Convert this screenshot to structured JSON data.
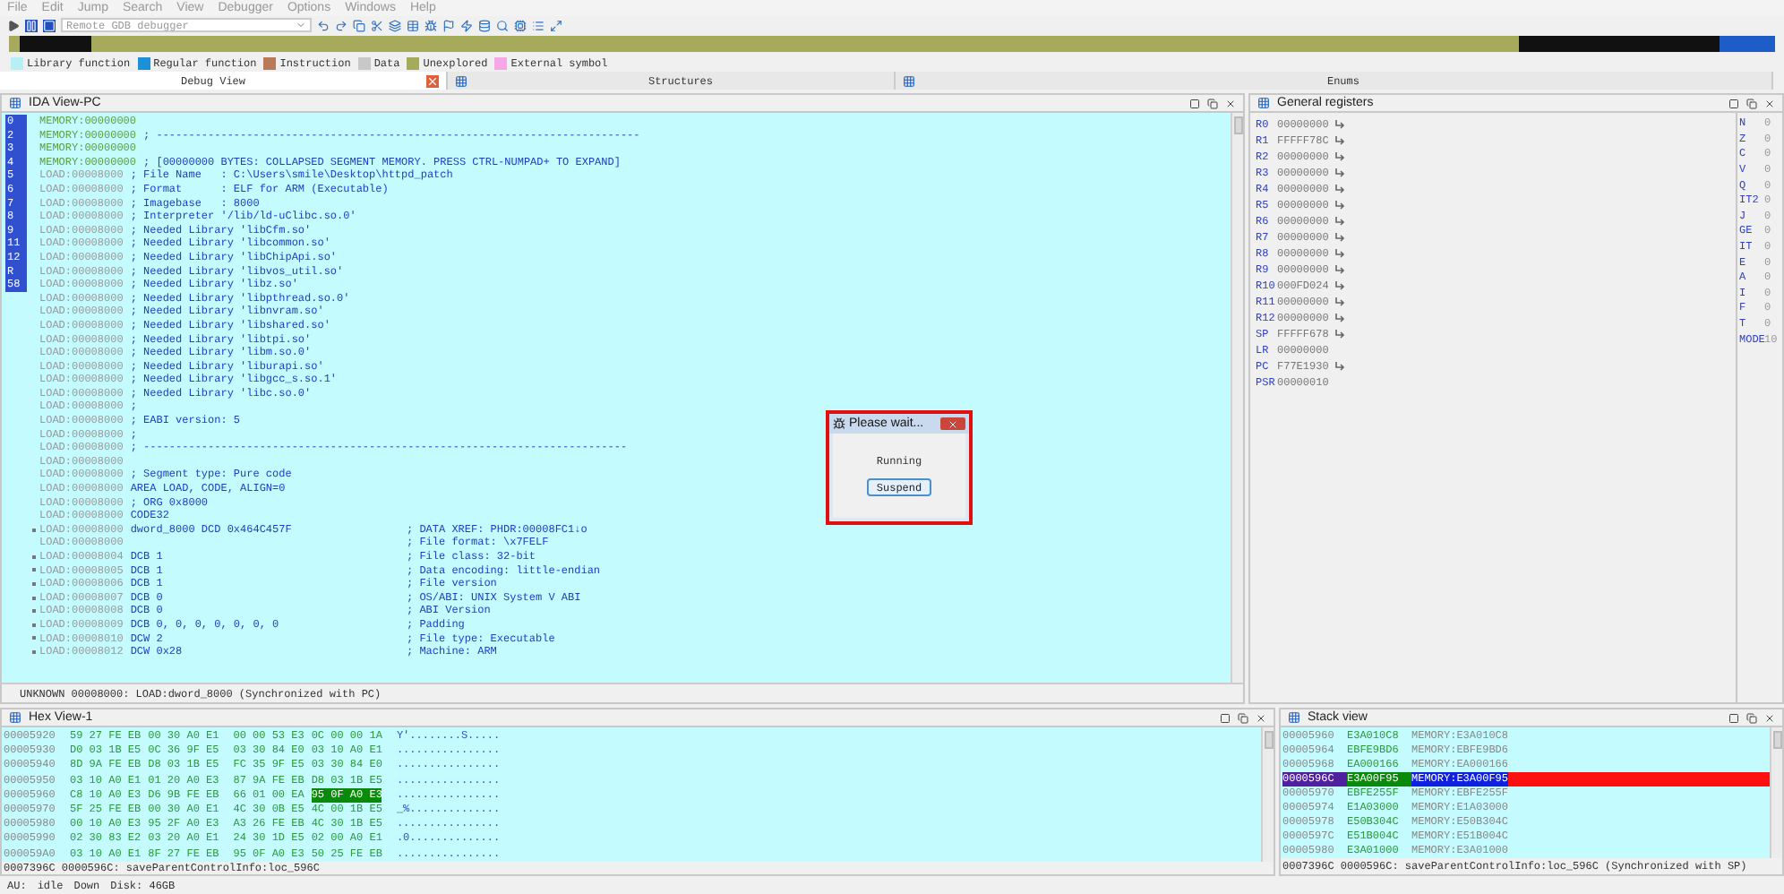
{
  "menu": [
    "File",
    "Edit",
    "Jump",
    "Search",
    "View",
    "Debugger",
    "Options",
    "Windows",
    "Help"
  ],
  "toolbar": {
    "debugger": "Remote GDB debugger"
  },
  "legend": [
    {
      "label": "Library function",
      "color": "#b6f0f5"
    },
    {
      "label": "Regular function",
      "color": "#1e90d8"
    },
    {
      "label": "Instruction",
      "color": "#b97a57"
    },
    {
      "label": "Data",
      "color": "#c8c8c8"
    },
    {
      "label": "Unexplored",
      "color": "#a5ab5a"
    },
    {
      "label": "External symbol",
      "color": "#f7a6e6"
    }
  ],
  "tabs": [
    {
      "label": "Debug View",
      "selected": true
    },
    {
      "label": "Structures",
      "selected": false
    },
    {
      "label": "Enums",
      "selected": false
    }
  ],
  "ida_view": {
    "title": "IDA View-PC",
    "gutter_marks": [
      "0",
      "2",
      "3",
      "4",
      "5",
      "6",
      "7",
      "8",
      "9",
      "11",
      "12",
      "R",
      "58"
    ],
    "lines": [
      {
        "kind": "memory",
        "address": "MEMORY:00000000",
        "marked": false
      },
      {
        "kind": "memory",
        "address": "MEMORY:00000000",
        "code": "; ---------------------------------------------------------------------------",
        "marked": false
      },
      {
        "kind": "memory",
        "address": "MEMORY:00000000",
        "marked": false
      },
      {
        "kind": "memory",
        "address": "MEMORY:00000000",
        "code": "; [00000000 BYTES: COLLAPSED SEGMENT MEMORY. PRESS CTRL-NUMPAD+ TO EXPAND]",
        "marked": false
      },
      {
        "kind": "load",
        "address": "LOAD:00008000",
        "code": "; File Name   : C:\\Users\\smile\\Desktop\\httpd_patch",
        "marked": false
      },
      {
        "kind": "load",
        "address": "LOAD:00008000",
        "code": "; Format      : ELF for ARM (Executable)",
        "marked": false
      },
      {
        "kind": "load",
        "address": "LOAD:00008000",
        "code": "; Imagebase   : 8000",
        "marked": false
      },
      {
        "kind": "load",
        "address": "LOAD:00008000",
        "code": "; Interpreter '/lib/ld-uClibc.so.0'",
        "marked": false
      },
      {
        "kind": "load",
        "address": "LOAD:00008000",
        "code": "; Needed Library 'libCfm.so'",
        "marked": false
      },
      {
        "kind": "load",
        "address": "LOAD:00008000",
        "code": "; Needed Library 'libcommon.so'",
        "marked": false
      },
      {
        "kind": "load",
        "address": "LOAD:00008000",
        "code": "; Needed Library 'libChipApi.so'",
        "marked": false
      },
      {
        "kind": "load",
        "address": "LOAD:00008000",
        "code": "; Needed Library 'libvos_util.so'",
        "marked": false
      },
      {
        "kind": "load",
        "address": "LOAD:00008000",
        "code": "; Needed Library 'libz.so'",
        "marked": false
      },
      {
        "kind": "load",
        "address": "LOAD:00008000",
        "code": "; Needed Library 'libpthread.so.0'",
        "marked": false
      },
      {
        "kind": "load",
        "address": "LOAD:00008000",
        "code": "; Needed Library 'libnvram.so'",
        "marked": false
      },
      {
        "kind": "load",
        "address": "LOAD:00008000",
        "code": "; Needed Library 'libshared.so'",
        "marked": false
      },
      {
        "kind": "load",
        "address": "LOAD:00008000",
        "code": "; Needed Library 'libtpi.so'",
        "marked": false
      },
      {
        "kind": "load",
        "address": "LOAD:00008000",
        "code": "; Needed Library 'libm.so.0'",
        "marked": false
      },
      {
        "kind": "load",
        "address": "LOAD:00008000",
        "code": "; Needed Library 'liburapi.so'",
        "marked": false
      },
      {
        "kind": "load",
        "address": "LOAD:00008000",
        "code": "; Needed Library 'libgcc_s.so.1'",
        "marked": false
      },
      {
        "kind": "load",
        "address": "LOAD:00008000",
        "code": "; Needed Library 'libc.so.0'",
        "marked": false
      },
      {
        "kind": "load",
        "address": "LOAD:00008000",
        "code": ";",
        "marked": false
      },
      {
        "kind": "load",
        "address": "LOAD:00008000",
        "code": "; EABI version: 5",
        "marked": false
      },
      {
        "kind": "load",
        "address": "LOAD:00008000",
        "code": ";",
        "marked": false
      },
      {
        "kind": "load",
        "address": "LOAD:00008000",
        "code": "; ---------------------------------------------------------------------------",
        "marked": false
      },
      {
        "kind": "load",
        "address": "LOAD:00008000",
        "marked": false
      },
      {
        "kind": "load",
        "address": "LOAD:00008000",
        "code": "; Segment type: Pure code",
        "marked": false
      },
      {
        "kind": "load",
        "address": "LOAD:00008000",
        "code": "AREA LOAD, CODE, ALIGN=0",
        "marked": false
      },
      {
        "kind": "load",
        "address": "LOAD:00008000",
        "code": "; ORG 0x8000",
        "marked": false
      },
      {
        "kind": "load",
        "address": "LOAD:00008000",
        "code": "CODE32",
        "marked": false
      },
      {
        "kind": "load",
        "address": "LOAD:00008000",
        "code": "dword_8000 DCD 0x464C457F",
        "comment": "; DATA XREF: PHDR:00008FC1↓o",
        "marked": true
      },
      {
        "kind": "load",
        "address": "LOAD:00008000",
        "comment": "; File format: \\x7FELF",
        "marked": false
      },
      {
        "kind": "load",
        "address": "LOAD:00008004",
        "code": "DCB 1",
        "comment": "; File class: 32-bit",
        "marked": true
      },
      {
        "kind": "load",
        "address": "LOAD:00008005",
        "code": "DCB 1",
        "comment": "; Data encoding: little-endian",
        "marked": true
      },
      {
        "kind": "load",
        "address": "LOAD:00008006",
        "code": "DCB 1",
        "comment": "; File version",
        "marked": true
      },
      {
        "kind": "load",
        "address": "LOAD:00008007",
        "code": "DCB 0",
        "comment": "; OS/ABI: UNIX System V ABI",
        "marked": true
      },
      {
        "kind": "load",
        "address": "LOAD:00008008",
        "code": "DCB 0",
        "comment": "; ABI Version",
        "marked": true
      },
      {
        "kind": "load",
        "address": "LOAD:00008009",
        "code": "DCB 0, 0, 0, 0, 0, 0, 0",
        "comment": "; Padding",
        "marked": true
      },
      {
        "kind": "load",
        "address": "LOAD:00008010",
        "code": "DCW 2",
        "comment": "; File type: Executable",
        "marked": true
      },
      {
        "kind": "load",
        "address": "LOAD:00008012",
        "code": "DCW 0x28",
        "comment": "; Machine: ARM",
        "marked": true
      }
    ],
    "status": "UNKNOWN 00008000: LOAD:dword_8000 (Synchronized with PC)"
  },
  "dialog": {
    "title": "Please wait...",
    "message": "Running",
    "button": "Suspend"
  },
  "registers": {
    "title": "General registers",
    "items": [
      {
        "name": "R0",
        "value": "00000000",
        "link": true
      },
      {
        "name": "R1",
        "value": "FFFFF78C",
        "link": true
      },
      {
        "name": "R2",
        "value": "00000000",
        "link": true
      },
      {
        "name": "R3",
        "value": "00000000",
        "link": true
      },
      {
        "name": "R4",
        "value": "00000000",
        "link": true
      },
      {
        "name": "R5",
        "value": "00000000",
        "link": true
      },
      {
        "name": "R6",
        "value": "00000000",
        "link": true
      },
      {
        "name": "R7",
        "value": "00000000",
        "link": true
      },
      {
        "name": "R8",
        "value": "00000000",
        "link": true
      },
      {
        "name": "R9",
        "value": "00000000",
        "link": true
      },
      {
        "name": "R10",
        "value": "000FD024",
        "link": true
      },
      {
        "name": "R11",
        "value": "00000000",
        "link": true
      },
      {
        "name": "R12",
        "value": "00000000",
        "link": true
      },
      {
        "name": "SP",
        "value": "FFFFF678",
        "link": true
      },
      {
        "name": "LR",
        "value": "00000000",
        "link": false
      },
      {
        "name": "PC",
        "value": "F77E1930",
        "link": true
      },
      {
        "name": "PSR",
        "value": "00000010",
        "link": false
      }
    ],
    "flags": [
      {
        "name": "N",
        "value": "0"
      },
      {
        "name": "Z",
        "value": "0"
      },
      {
        "name": "C",
        "value": "0"
      },
      {
        "name": "V",
        "value": "0"
      },
      {
        "name": "Q",
        "value": "0"
      },
      {
        "name": "IT2",
        "value": "0"
      },
      {
        "name": "J",
        "value": "0"
      },
      {
        "name": "GE",
        "value": "0"
      },
      {
        "name": "IT",
        "value": "0"
      },
      {
        "name": "E",
        "value": "0"
      },
      {
        "name": "A",
        "value": "0"
      },
      {
        "name": "I",
        "value": "0"
      },
      {
        "name": "F",
        "value": "0"
      },
      {
        "name": "T",
        "value": "0"
      },
      {
        "name": "MODE",
        "value": "10"
      }
    ]
  },
  "hex_view": {
    "title": "Hex View-1",
    "rows": [
      {
        "address": "00005920",
        "groups": [
          {
            "text": "59 27 FE EB",
            "selected": false
          },
          {
            "text": "00 30 A0 E1",
            "selected": false
          },
          {
            "text": "00 00 53 E3",
            "selected": false
          },
          {
            "text": "0C 00 00 1A",
            "selected": false
          }
        ],
        "ascii": "Y'........S....."
      },
      {
        "address": "00005930",
        "groups": [
          {
            "text": "D0 03 1B E5",
            "selected": false
          },
          {
            "text": "0C 36 9F E5",
            "selected": false
          },
          {
            "text": "03 30 84 E0",
            "selected": false
          },
          {
            "text": "03 10 A0 E1",
            "selected": false
          }
        ],
        "ascii": "................"
      },
      {
        "address": "00005940",
        "groups": [
          {
            "text": "8D 9A FE EB",
            "selected": false
          },
          {
            "text": "D8 03 1B E5",
            "selected": false
          },
          {
            "text": "FC 35 9F E5",
            "selected": false
          },
          {
            "text": "03 30 84 E0",
            "selected": false
          }
        ],
        "ascii": "................"
      },
      {
        "address": "00005950",
        "groups": [
          {
            "text": "03 10 A0 E1",
            "selected": false
          },
          {
            "text": "01 20 A0 E3",
            "selected": false
          },
          {
            "text": "87 9A FE EB",
            "selected": false
          },
          {
            "text": "D8 03 1B E5",
            "selected": false
          }
        ],
        "ascii": "................"
      },
      {
        "address": "00005960",
        "groups": [
          {
            "text": "C8 10 A0 E3",
            "selected": false
          },
          {
            "text": "D6 9B FE EB",
            "selected": false
          },
          {
            "text": "66 01 00 EA",
            "selected": false
          },
          {
            "text": "95 0F A0 E3",
            "selected": true
          }
        ],
        "ascii": "................"
      },
      {
        "address": "00005970",
        "groups": [
          {
            "text": "5F 25 FE EB",
            "selected": false
          },
          {
            "text": "00 30 A0 E1",
            "selected": false
          },
          {
            "text": "4C 30 0B E5",
            "selected": false
          },
          {
            "text": "4C 00 1B E5",
            "selected": false
          }
        ],
        "ascii": "_%.............."
      },
      {
        "address": "00005980",
        "groups": [
          {
            "text": "00 10 A0 E3",
            "selected": false
          },
          {
            "text": "95 2F A0 E3",
            "selected": false
          },
          {
            "text": "A3 26 FE EB",
            "selected": false
          },
          {
            "text": "4C 30 1B E5",
            "selected": false
          }
        ],
        "ascii": "................"
      },
      {
        "address": "00005990",
        "groups": [
          {
            "text": "02 30 83 E2",
            "selected": false
          },
          {
            "text": "03 20 A0 E1",
            "selected": false
          },
          {
            "text": "24 30 1D E5",
            "selected": false
          },
          {
            "text": "02 00 A0 E1",
            "selected": false
          }
        ],
        "ascii": ".0.............."
      },
      {
        "address": "000059A0",
        "groups": [
          {
            "text": "03 10 A0 E1",
            "selected": false
          },
          {
            "text": "8F 27 FE EB",
            "selected": false
          },
          {
            "text": "95 0F A0 E3",
            "selected": false
          },
          {
            "text": "50 25 FE EB",
            "selected": false
          }
        ],
        "ascii": "................"
      }
    ],
    "status": "0007396C 0000596C: saveParentControlInfo:loc_596C"
  },
  "stack_view": {
    "title": "Stack view",
    "rows": [
      {
        "address": "00005960",
        "value": "E3A010C8",
        "target": "MEMORY:E3A010C8",
        "selected": false
      },
      {
        "address": "00005964",
        "value": "EBFE9BD6",
        "target": "MEMORY:EBFE9BD6",
        "selected": false
      },
      {
        "address": "00005968",
        "value": "EA000166",
        "target": "MEMORY:EA000166",
        "selected": false
      },
      {
        "address": "0000596C",
        "value": "E3A00F95",
        "target": "MEMORY:E3A00F95",
        "selected": true
      },
      {
        "address": "00005970",
        "value": "EBFE255F",
        "target": "MEMORY:EBFE255F",
        "selected": false
      },
      {
        "address": "00005974",
        "value": "E1A03000",
        "target": "MEMORY:E1A03000",
        "selected": false
      },
      {
        "address": "00005978",
        "value": "E50B304C",
        "target": "MEMORY:E50B304C",
        "selected": false
      },
      {
        "address": "0000597C",
        "value": "E51B004C",
        "target": "MEMORY:E51B004C",
        "selected": false
      },
      {
        "address": "00005980",
        "value": "E3A01000",
        "target": "MEMORY:E3A01000",
        "selected": false
      }
    ],
    "status": "0007396C 0000596C: saveParentControlInfo:loc_596C (Synchronized with SP)"
  },
  "status_bar": [
    "AU:",
    "idle",
    "Down",
    "Disk: 46GB"
  ]
}
